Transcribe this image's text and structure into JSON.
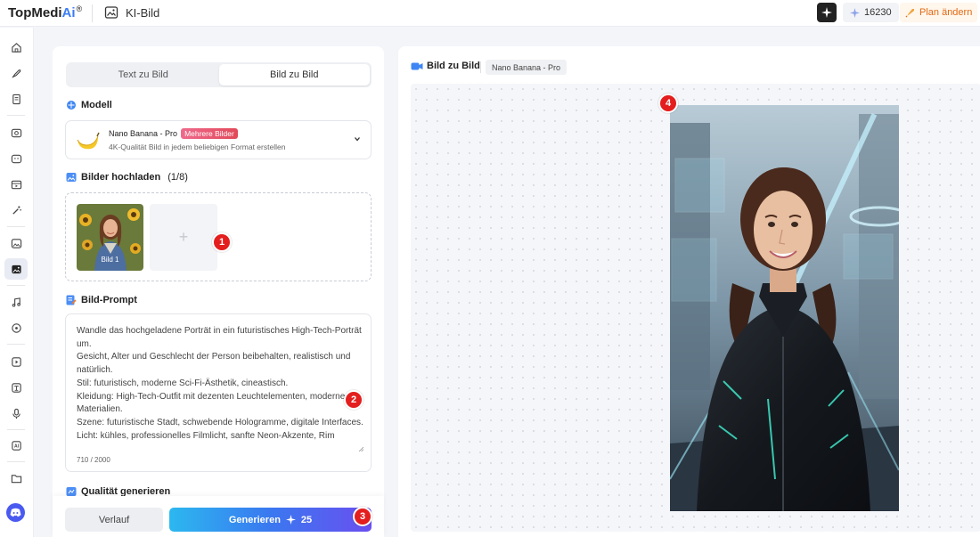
{
  "app": {
    "brand_prefix": "TopMedi",
    "brand_ai": "Ai",
    "brand_reg": "®",
    "page_title": "KI-Bild"
  },
  "topbar": {
    "credits": "16230",
    "plan_label": "Plan ändern"
  },
  "sidebar": {
    "items": [
      "home-icon",
      "rocket-icon",
      "document-icon",
      "image-to-image-icon",
      "face-icon",
      "video-icon",
      "magic-wand-icon",
      "image-icon",
      "ai-image-icon",
      "music-icon",
      "audio-icon",
      "video-edit-icon",
      "translate-icon",
      "microphone-icon",
      "ai-box-icon",
      "folder-icon"
    ],
    "active": "ai-image-icon",
    "discord_icon": "discord-icon"
  },
  "left_panel": {
    "tabs": [
      {
        "label": "Text zu Bild",
        "active": false
      },
      {
        "label": "Bild zu Bild",
        "active": true
      }
    ],
    "model_section": "Modell",
    "model": {
      "name": "Nano Banana - Pro",
      "badge": "Mehrere Bilder",
      "description": "4K-Qualität Bild in jedem beliebigen Format erstellen"
    },
    "upload_section": "Bilder hochladen",
    "upload_count": "(1/8)",
    "uploaded_image_label": "Bild 1",
    "add_symbol": "+",
    "prompt_section": "Bild-Prompt",
    "prompt_text": "Wandle das hochgeladene Porträt in ein futuristisches High-Tech-Porträt um.\nGesicht, Alter und Geschlecht der Person beibehalten, realistisch und natürlich.\nStil: futuristisch, moderne Sci-Fi-Ästhetik, cineastisch.\nKleidung: High-Tech-Outfit mit dezenten Leuchtelementen, moderne Materialien.\nSzene: futuristische Stadt, schwebende Hologramme, digitale Interfaces.\nLicht: kühles, professionelles Filmlicht, sanfte Neon-Akzente, Rim",
    "prompt_count": "710 / 2000",
    "quality_section": "Qualität generieren",
    "history_button": "Verlauf",
    "generate_button": "Generieren",
    "generate_cost": "25"
  },
  "right_panel": {
    "title": "Bild zu Bild",
    "model_chip": "Nano Banana - Pro"
  },
  "markers": [
    "1",
    "2",
    "3",
    "4"
  ],
  "colors": {
    "brand_blue": "#3b7cf6",
    "plan_orange": "#e06a14",
    "marker_red": "#e41e1e",
    "badge_pink": "#e24a5a",
    "generate_gradient_start": "#2cb8ef",
    "generate_gradient_end": "#6a4ff0"
  }
}
